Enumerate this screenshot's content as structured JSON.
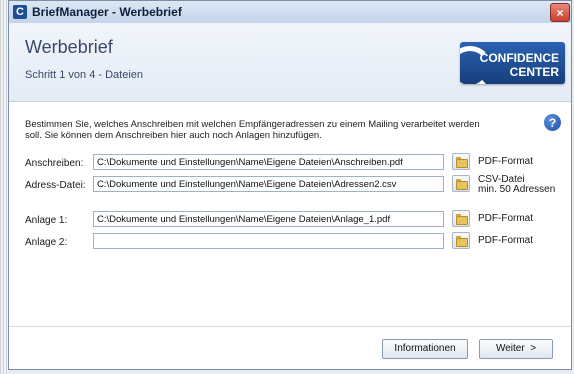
{
  "window": {
    "app_icon": "C",
    "title": "BriefManager - Werbebrief",
    "close": "×"
  },
  "header": {
    "title": "Werbebrief",
    "subtitle": "Schritt 1 von 4 - Dateien"
  },
  "logo": {
    "line1": "CONFIDENCE",
    "line2": "CENTER"
  },
  "description": "Bestimmen Sie, welches Anschreiben mit welchen Empfängeradressen zu einem Mailing verarbeitet werden soll. Sie können dem Anschreiben hier auch noch Anlagen hinzufügen.",
  "help_icon": "?",
  "rows": [
    {
      "label": "Anschreiben:",
      "value": "C:\\Dokumente und Einstellungen\\Name\\Eigene Dateien\\Anschreiben.pdf",
      "format1": "PDF-Format",
      "format2": ""
    },
    {
      "label": "Adress-Datei:",
      "value": "C:\\Dokumente und Einstellungen\\Name\\Eigene Dateien\\Adressen2.csv",
      "format1": "CSV-Datei",
      "format2": "min. 50 Adressen"
    },
    {
      "label": "Anlage 1:",
      "value": "C:\\Dokumente und Einstellungen\\Name\\Eigene Dateien\\Anlage_1.pdf",
      "format1": "PDF-Format",
      "format2": ""
    },
    {
      "label": "Anlage 2:",
      "value": "",
      "format1": "PDF-Format",
      "format2": ""
    }
  ],
  "buttons": {
    "info": "Informationen",
    "next": "Weiter  >"
  },
  "icons": {
    "folder": "folder-icon",
    "help": "help-icon",
    "close": "close-icon",
    "logo": "confidence-center-logo"
  }
}
